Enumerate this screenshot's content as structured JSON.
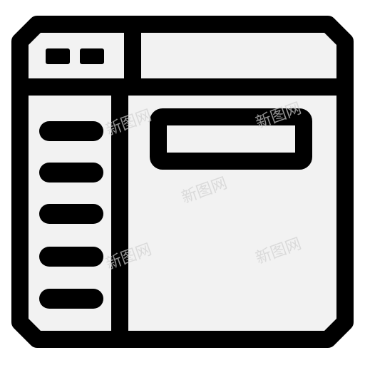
{
  "icon": {
    "name": "browser-window-layout-icon",
    "stroke_color": "#000000",
    "fill_color": "#f2f2f2",
    "background_color": "#ffffff"
  },
  "watermark": {
    "text": "新图网"
  },
  "sidebar": {
    "item_count": 5
  },
  "titlebar": {
    "dot_count": 2
  }
}
